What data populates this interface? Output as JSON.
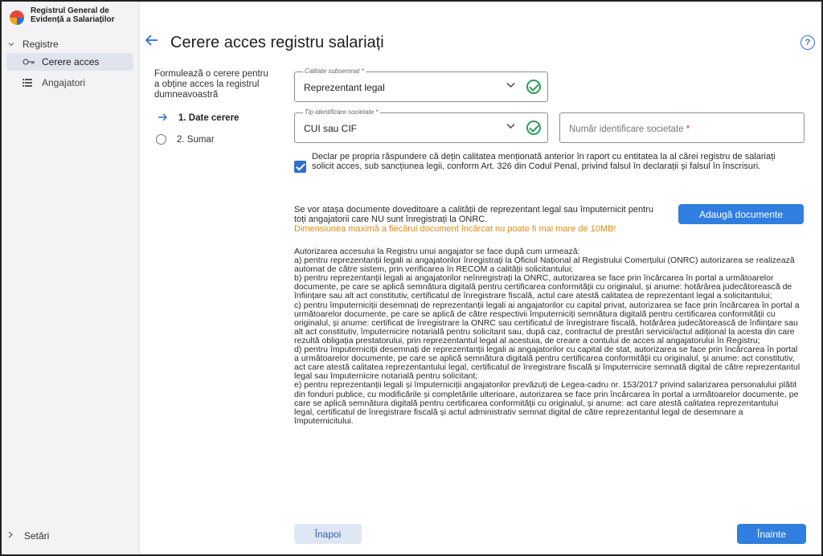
{
  "app": {
    "logo_text": "Registrul General de Evidență a Salariaților"
  },
  "sidebar": {
    "group_label": "Registre",
    "items": [
      {
        "label": "Cerere acces",
        "icon": "key-icon",
        "active": true
      },
      {
        "label": "Angajatori",
        "icon": "list-icon",
        "active": false
      }
    ],
    "settings_label": "Setări"
  },
  "header": {
    "title": "Cerere acces registru salariați",
    "help_glyph": "?"
  },
  "steps": {
    "intro": "Formulează o cerere pentru a obține acces la registrul dumneavoastră",
    "items": [
      {
        "label": "1. Date cerere",
        "active": true
      },
      {
        "label": "2. Sumar",
        "active": false
      }
    ]
  },
  "form": {
    "calitate": {
      "label": "Calitate subsemnat *",
      "value": "Reprezentant legal"
    },
    "tip_identificare": {
      "label": "Tip identificare societate *",
      "value": "CUI sau CIF"
    },
    "numar_identificare": {
      "placeholder": "Număr identificare societate",
      "required_mark": "*"
    },
    "declaration": "Declar pe propria răspundere că dețin calitatea menționată anterior în raport cu entitatea la al cărei registru de salariați solicit acces, sub sancțiunea legii, conform Art. 326 din Codul Penal, privind falsul în declarații și falsul în înscrisuri.",
    "declaration_checked": true
  },
  "attachments": {
    "info": "Se vor atașa documente doveditoare a calității de reprezentant legal sau împuternicit pentru toți angajatorii care NU sunt înregistrați la ONRC.",
    "warning": "Dimensiunea maximă a fiecărui document încărcat nu poate fi mai mare de 10MB!",
    "button_label": "Adaugă documente"
  },
  "legal_text": "Autorizarea accesului la Registru unui angajator se face după cum urmează:\n     a) pentru reprezentanții legali ai angajatorilor înregistrați la Oficiul Național al Registrului Comerțului (ONRC) autorizarea se realizează automat de către sistem, prin verificarea în RECOM a calității solicitantului;\n     b) pentru reprezentanții legali ai angajatorilor neînregistrați la ONRC, autorizarea se face prin încărcarea în portal a următoarelor documente, pe care se aplică semnătura digitală pentru certificarea conformității cu originalul, și anume: hotărârea judecătorească de înființare sau alt act constitutiv, certificatul de înregistrare fiscală, actul care atestă calitatea de reprezentant legal a solicitantului;\n     c) pentru împuterniciții desemnați de reprezentanții legali ai angajatorilor cu capital privat, autorizarea se face prin încărcarea în portal a următoarelor documente, pe care se aplică de către respectivii împuterniciți semnătura digitală pentru certificarea conformității cu originalul, și anume: certificat de înregistrare la ONRC sau certificatul de înregistrare fiscală, hotărârea judecătorească de înființare sau alt act constitutiv, împuternicire notarială pentru solicitant sau, după caz, contractul de prestări servicii/actul adițional la acesta din care rezultă obligația prestatorului, prin reprezentantul legal al acestuia, de creare a contului de acces al angajatorului în Registru;\n     d) pentru împuterniciții desemnați de reprezentanții legali ai angajatorilor cu capital de stat, autorizarea se face prin încărcarea în portal a următoarelor documente, pe care se aplică semnătura digitală pentru certificarea conformității cu originalul, și anume: act constitutiv, act care atestă calitatea reprezentantului legal, certificatul de înregistrare fiscală și împuternicire semnată digital de către reprezentantul legal sau împuternicire notarială pentru solicitant;\n     e) pentru reprezentanții legali și împuterniciții angajatorilor prevăzuți de Legea-cadru nr. 153/2017 privind salarizarea personalului plătit din fonduri publice, cu modificările și completările ulterioare, autorizarea se face prin încărcarea în portal a următoarelor documente, pe care se aplică semnătura digitală pentru certificarea conformității cu originalul, și anume: act care atestă calitatea reprezentantului legal, certificatul de înregistrare fiscală și actul administrativ semnat digital de către reprezentantul legal de desemnare a împuternicitului.",
  "footer": {
    "back_label": "Înapoi",
    "next_label": "Înainte"
  },
  "colors": {
    "primary": "#2f7ee0",
    "success": "#2e9b5b",
    "warning": "#e08a13",
    "required": "#d63b3b"
  }
}
